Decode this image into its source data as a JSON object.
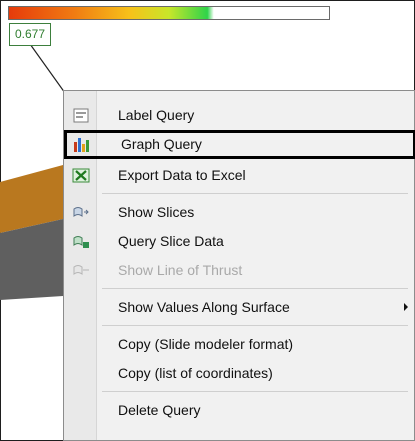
{
  "value_label": "0.677",
  "menu": {
    "items": [
      {
        "label": "Label Query",
        "icon": "label-query-icon",
        "enabled": true
      },
      {
        "label": "Graph Query",
        "icon": "graph-query-icon",
        "enabled": true
      },
      {
        "label": "Export Data to Excel",
        "icon": "excel-export-icon",
        "enabled": true
      },
      {
        "label": "Show Slices",
        "icon": "slices-icon",
        "enabled": true
      },
      {
        "label": "Query Slice Data",
        "icon": "slice-data-icon",
        "enabled": true
      },
      {
        "label": "Show Line of Thrust",
        "icon": "line-of-thrust-icon",
        "enabled": false
      },
      {
        "label": "Show Values Along Surface",
        "icon": "",
        "enabled": true,
        "submenu": true
      },
      {
        "label": "Copy (Slide modeler format)",
        "icon": "",
        "enabled": true
      },
      {
        "label": "Copy (list of coordinates)",
        "icon": "",
        "enabled": true
      },
      {
        "label": "Delete Query",
        "icon": "",
        "enabled": true
      }
    ]
  },
  "colors": {
    "value_label_text": "#2f7d2f",
    "orange_layer": "#b9781f",
    "gray_layer": "#5f5f5f",
    "highlight_border": "#000000"
  }
}
